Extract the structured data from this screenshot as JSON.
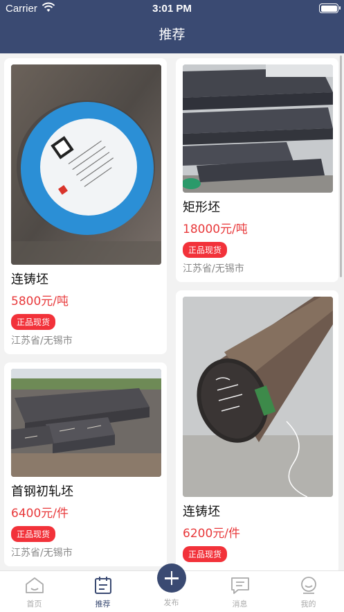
{
  "status_bar": {
    "carrier": "Carrier",
    "time": "3:01 PM"
  },
  "nav": {
    "title": "推荐"
  },
  "products": [
    {
      "name": "连铸坯",
      "price": "5800元/吨",
      "badge": "正品现货",
      "location": "江苏省/无锡市",
      "image": "round-billet-label-photo"
    },
    {
      "name": "首钢初轧坯",
      "price": "6400元/件",
      "badge": "正品现货",
      "location": "江苏省/无锡市",
      "image": "steel-slabs-yard-photo"
    },
    {
      "name": "矩形坯",
      "price": "18000元/吨",
      "badge": "正品现货",
      "location": "江苏省/无锡市",
      "image": "stacked-rectangular-billets-photo"
    },
    {
      "name": "连铸坯",
      "price": "6200元/件",
      "badge": "正品现货",
      "location": "",
      "image": "round-billet-end-photo"
    }
  ],
  "tabs": [
    {
      "label": "首页",
      "icon": "home-icon",
      "active": false
    },
    {
      "label": "推荐",
      "icon": "recommend-icon",
      "active": true
    },
    {
      "label": "发布",
      "icon": "publish-plus-icon",
      "active": false
    },
    {
      "label": "消息",
      "icon": "message-icon",
      "active": false
    },
    {
      "label": "我的",
      "icon": "profile-icon",
      "active": false
    }
  ],
  "colors": {
    "nav_bg": "#3a4a72",
    "price": "#e8383a",
    "badge_bg": "#f2323a",
    "page_bg": "#f2f2f2"
  }
}
